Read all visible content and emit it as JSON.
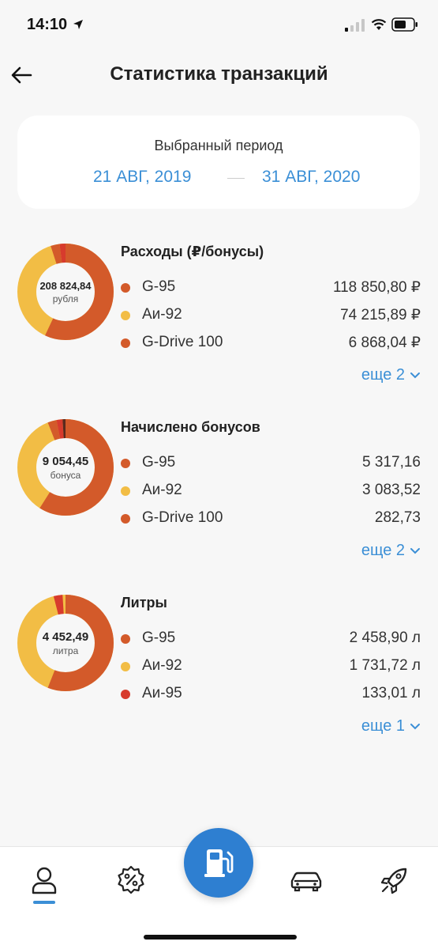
{
  "status": {
    "time": "14:10"
  },
  "header": {
    "title": "Статистика транзакций"
  },
  "period": {
    "label": "Выбранный период",
    "from": "21 АВГ, 2019",
    "to": "31 АВГ, 2020"
  },
  "colors": {
    "orange": "#d35a2a",
    "yellow": "#f2bd45",
    "red": "#d73b2d",
    "dark": "#5a2a1e",
    "accent": "#3b8fd6"
  },
  "blocks": [
    {
      "title": "Расходы (₽/бонусы)",
      "total": "208 824,84",
      "unit": "рубля",
      "items": [
        {
          "name": "G-95",
          "value": "118 850,80 ₽",
          "color": "#d35a2a"
        },
        {
          "name": "Аи-92",
          "value": "74 215,89 ₽",
          "color": "#f2bd45"
        },
        {
          "name": "G-Drive 100",
          "value": "6 868,04 ₽",
          "color": "#d35a2a"
        }
      ],
      "more": "еще 2"
    },
    {
      "title": "Начислено бонусов",
      "total": "9 054,45",
      "unit": "бонуса",
      "items": [
        {
          "name": "G-95",
          "value": "5 317,16",
          "color": "#d35a2a"
        },
        {
          "name": "Аи-92",
          "value": "3 083,52",
          "color": "#f2bd45"
        },
        {
          "name": "G-Drive 100",
          "value": "282,73",
          "color": "#d35a2a"
        }
      ],
      "more": "еще 2"
    },
    {
      "title": "Литры",
      "total": "4 452,49",
      "unit": "литра",
      "items": [
        {
          "name": "G-95",
          "value": "2 458,90 л",
          "color": "#d35a2a"
        },
        {
          "name": "Аи-92",
          "value": "1 731,72 л",
          "color": "#f2bd45"
        },
        {
          "name": "Аи-95",
          "value": "133,01 л",
          "color": "#d73b2d"
        }
      ],
      "more": "еще 1"
    }
  ],
  "tabs": {
    "items": [
      "profile-icon",
      "discount-icon",
      "fuel-icon",
      "car-icon",
      "rocket-icon"
    ],
    "active": "profile-icon"
  }
}
